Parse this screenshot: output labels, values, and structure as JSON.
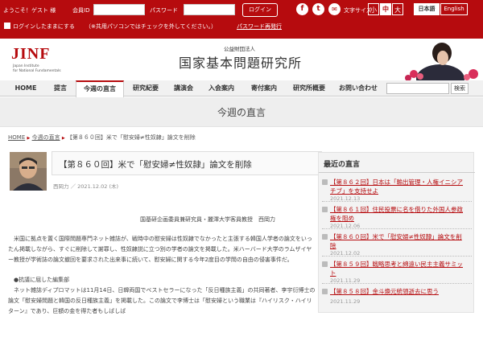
{
  "topbar": {
    "welcome": "ようこそ！ゲスト 様",
    "member_id_label": "会員ID",
    "password_label": "パスワード",
    "login_button": "ログイン",
    "font_size_label": "文字サイズ",
    "font_sizes": [
      "小",
      "中",
      "大"
    ],
    "lang_ja": "日本語",
    "lang_en": "English",
    "save_login_label": "ログインしたままにする",
    "save_login_note": "（※共用パソコンではチェックを外してください。）",
    "reissue_password": "パスワード再発行",
    "social": {
      "facebook": "f",
      "twitter": "t",
      "email": "✉"
    }
  },
  "header": {
    "logo_main": "JINF",
    "logo_sub1": "Japan Institute",
    "logo_sub2": "for National Fundamentals",
    "org_small": "公益財団法人",
    "org_name": "国家基本問題研究所"
  },
  "nav": {
    "items": [
      "HOME",
      "提言",
      "今週の直言",
      "研究紀要",
      "講演会",
      "入会案内",
      "寄付案内",
      "研究所概要",
      "お問い合わせ"
    ],
    "active_index": 2,
    "search_button": "検索",
    "search_placeholder": ""
  },
  "page_title": "今週の直言",
  "breadcrumb": {
    "home": "HOME",
    "sep": "▶",
    "section": "今週の直言",
    "current": "【第８６０回】米で「慰安婦≠性奴隷」論文を削除"
  },
  "article": {
    "title": "【第８６０回】米で「慰安婦≠性奴隷」論文を削除",
    "author": "西岡力",
    "date_sep": "／",
    "date": "2021.12.02 (木)",
    "byline": "国基研企画委員兼研究員・麗澤大学客員教授　西岡力",
    "paragraphs": [
      "米国に拠点を置く国際問題専門ネット雑誌が、戦時中の慰安婦は性奴隷でなかったと主張する韓国人学者の論文をいったん掲載しながら、すぐに削除して謝罪し、性奴隷説に立つ別の学者の論文を掲載した。米ハーバード大学のラムザイヤー教授が学術誌の論文撤回を要求された出来事に続いて、慰安婦に関する今年2度目の学問の自由の侵害事件だ。",
      "●抗議に屈した編集部",
      "ネット雑誌ディプロマットは11月14日、日韓両国でベストセラーになった「反日種族主義」の共同著者、李宇衍博士の論文「慰安婦問題と韓国の反日種族主義」を掲載した。この論文で李博士は「慰安婦という職業は『ハイリスク・ハイリターン』であり、巨額の金を得た者もしばしば"
    ]
  },
  "sidebar": {
    "title": "最近の直言",
    "items": [
      {
        "title": "【第８６２回】日本は「輸出管理・人権イニシアチブ」を支持せよ",
        "date": "2021.12.13"
      },
      {
        "title": "【第８６１回】住民投票に名を借りた外国人参政権を阻め",
        "date": "2021.12.06"
      },
      {
        "title": "【第８６０回】米で「慰安婦≠性奴隷」論文を削除",
        "date": "2021.12.02"
      },
      {
        "title": "【第８５９回】戦略思考と綿遠い民主主義サミット",
        "date": "2021.11.29"
      },
      {
        "title": "【第８５８回】金斗煥元統領逝去に思う",
        "date": "2021.11.29"
      }
    ]
  }
}
